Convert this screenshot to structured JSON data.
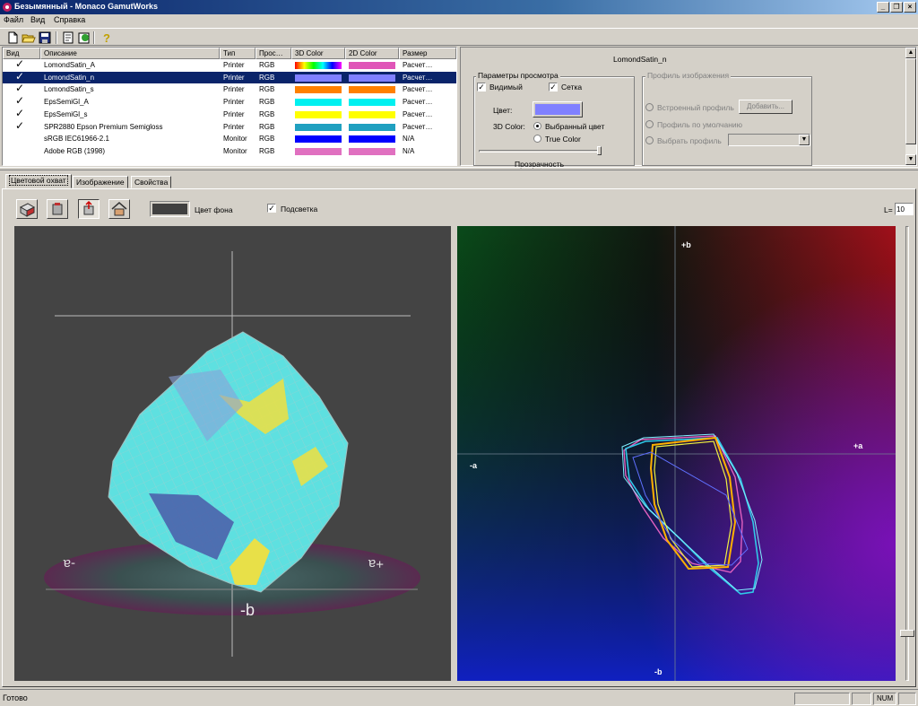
{
  "window": {
    "title": "Безымянный - Monaco GamutWorks",
    "controls": [
      "_",
      "❐",
      "×"
    ]
  },
  "menu": [
    "Файл",
    "Вид",
    "Справка"
  ],
  "toolbar": [
    "new-icon",
    "open-icon",
    "save-icon",
    "properties-icon",
    "refresh-icon",
    "help-icon"
  ],
  "profile_list": {
    "columns": [
      "Вид",
      "Описание",
      "Тип",
      "Прос…",
      "3D Color",
      "2D Color",
      "Размер"
    ],
    "rows": [
      {
        "checked": true,
        "desc": "LomondSatin_A",
        "type": "Printer",
        "space": "RGB",
        "c3d": "rainbow",
        "c2d": "#e055b8",
        "size": "Расчет…",
        "selected": false
      },
      {
        "checked": true,
        "desc": "LomondSatin_n",
        "type": "Printer",
        "space": "RGB",
        "c3d": "#8080ff",
        "c2d": "#8080ff",
        "size": "Расчет…",
        "selected": true
      },
      {
        "checked": true,
        "desc": "LomondSatin_s",
        "type": "Printer",
        "space": "RGB",
        "c3d": "#ff8000",
        "c2d": "#ff8000",
        "size": "Расчет…",
        "selected": false
      },
      {
        "checked": true,
        "desc": "EpsSemiGl_A",
        "type": "Printer",
        "space": "RGB",
        "c3d": "#00f0f0",
        "c2d": "#00f0f0",
        "size": "Расчет…",
        "selected": false
      },
      {
        "checked": true,
        "desc": "EpsSemiGl_s",
        "type": "Printer",
        "space": "RGB",
        "c3d": "#ffff00",
        "c2d": "#ffff00",
        "size": "Расчет…",
        "selected": false
      },
      {
        "checked": true,
        "desc": "SPR2880 Epson Premium Semigloss",
        "type": "Printer",
        "space": "RGB",
        "c3d": "#20a0c0",
        "c2d": "#20a0c0",
        "size": "Расчет…",
        "selected": false
      },
      {
        "checked": false,
        "desc": "sRGB IEC61966-2.1",
        "type": "Monitor",
        "space": "RGB",
        "c3d": "#0000ff",
        "c2d": "#0000ff",
        "size": "N/A",
        "selected": false
      },
      {
        "checked": false,
        "desc": "Adobe RGB (1998)",
        "type": "Monitor",
        "space": "RGB",
        "c3d": "#e070c0",
        "c2d": "#e070c0",
        "size": "N/A",
        "selected": false
      }
    ]
  },
  "props": {
    "profile_name": "LomondSatin_n",
    "view_params": {
      "label": "Параметры просмотра",
      "visible_label": "Видимый",
      "visible": true,
      "grid_label": "Сетка",
      "grid": true,
      "color_label": "Цвет:",
      "color_value": "#8080ff",
      "color3d_label": "3D Color:",
      "opt_selected": "Выбранный цвет",
      "opt_true": "True Color",
      "opacity_label": "Прозрачность"
    },
    "image_profile": {
      "label": "Профиль изображения",
      "embedded": "Встроенный профиль",
      "add_button": "Добавить...",
      "default": "Профиль по умолчанию",
      "choose": "Выбрать профиль"
    }
  },
  "tabs": [
    "Цветовой охват",
    "Изображение",
    "Свойства"
  ],
  "gamut_toolbar": {
    "tools": [
      "view-3d-icon",
      "view-cube-icon",
      "view-slice-icon",
      "view-home-icon"
    ],
    "bgcolor_label": "Цвет фона",
    "bgcolor_value": "#404040",
    "backlight_label": "Подсветка",
    "backlight": true,
    "l_label": "L=",
    "l_value": "10"
  },
  "view3d": {
    "axis_left": "-a",
    "axis_right": "+a",
    "axis_bottom": "-b"
  },
  "view2d": {
    "top": "+b",
    "bottom": "-b",
    "left": "-a",
    "right": "+a"
  },
  "status": {
    "text": "Готово",
    "num": "NUM"
  }
}
